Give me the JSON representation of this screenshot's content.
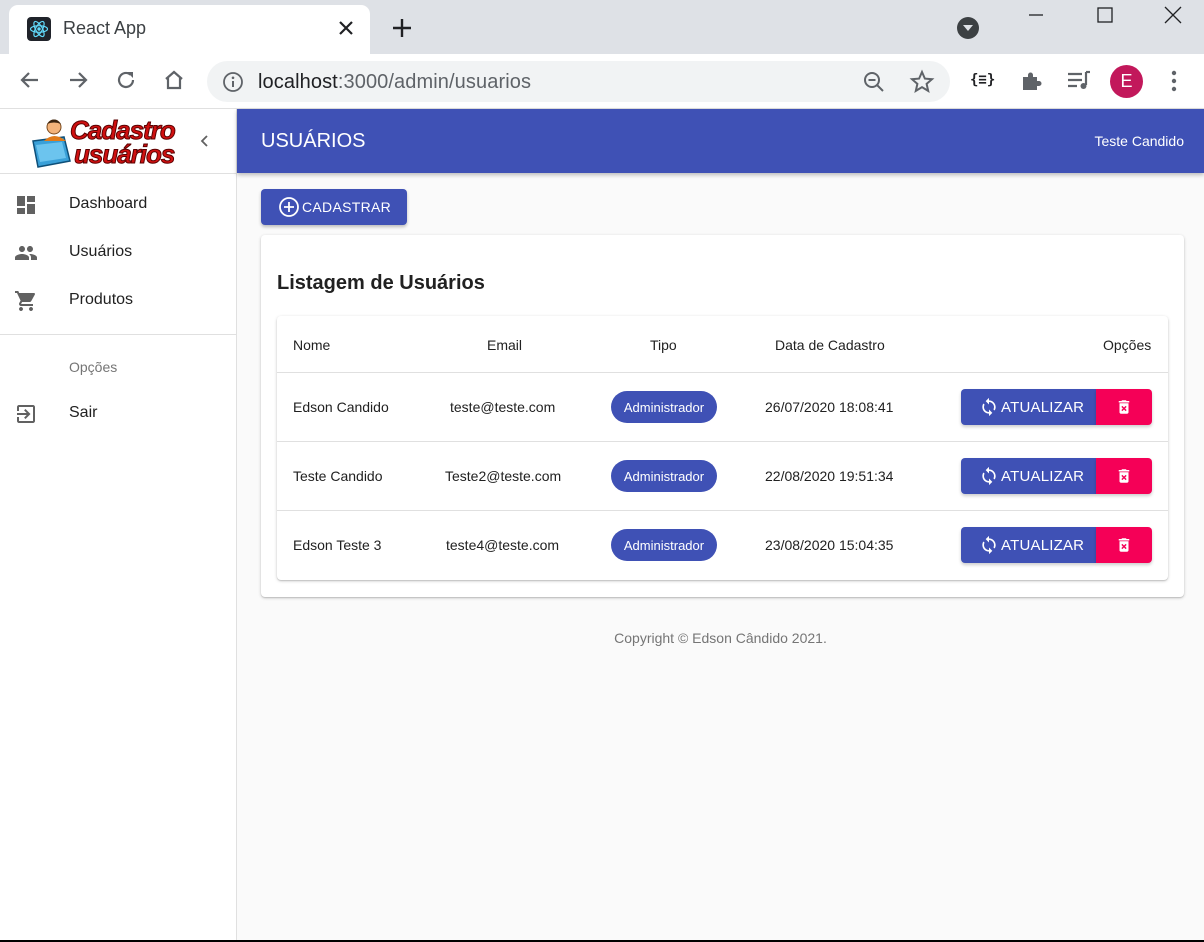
{
  "browser": {
    "tab_title": "React App",
    "url_host": "localhost",
    "url_path": ":3000/admin/usuarios",
    "profile_initial": "E",
    "extension_label": "{≡}"
  },
  "sidebar": {
    "logo_line1": "Cadastro",
    "logo_line2": "usuários",
    "items": [
      {
        "label": "Dashboard",
        "icon": "dashboard-icon"
      },
      {
        "label": "Usuários",
        "icon": "people-icon"
      },
      {
        "label": "Produtos",
        "icon": "shopping-cart-icon"
      }
    ],
    "section_header": "Opções",
    "logout_label": "Sair"
  },
  "appbar": {
    "title": "USUÁRIOS",
    "user": "Teste Candido"
  },
  "main": {
    "add_button_label": "CADASTRAR",
    "card_title": "Listagem de Usuários",
    "table": {
      "headers": [
        "Nome",
        "Email",
        "Tipo",
        "Data de Cadastro",
        "Opções"
      ],
      "rows": [
        {
          "nome": "Edson Candido",
          "email": "teste@teste.com",
          "tipo": "Administrador",
          "data": "26/07/2020 18:08:41"
        },
        {
          "nome": "Teste Candido",
          "email": "Teste2@teste.com",
          "tipo": "Administrador",
          "data": "22/08/2020 19:51:34"
        },
        {
          "nome": "Edson Teste 3",
          "email": "teste4@teste.com",
          "tipo": "Administrador",
          "data": "23/08/2020 15:04:35"
        }
      ],
      "update_label": "ATUALIZAR"
    }
  },
  "footer": {
    "copyright": "Copyright © Edson Cândido 2021."
  },
  "colors": {
    "primary": "#3f51b5",
    "secondary": "#f50057"
  }
}
